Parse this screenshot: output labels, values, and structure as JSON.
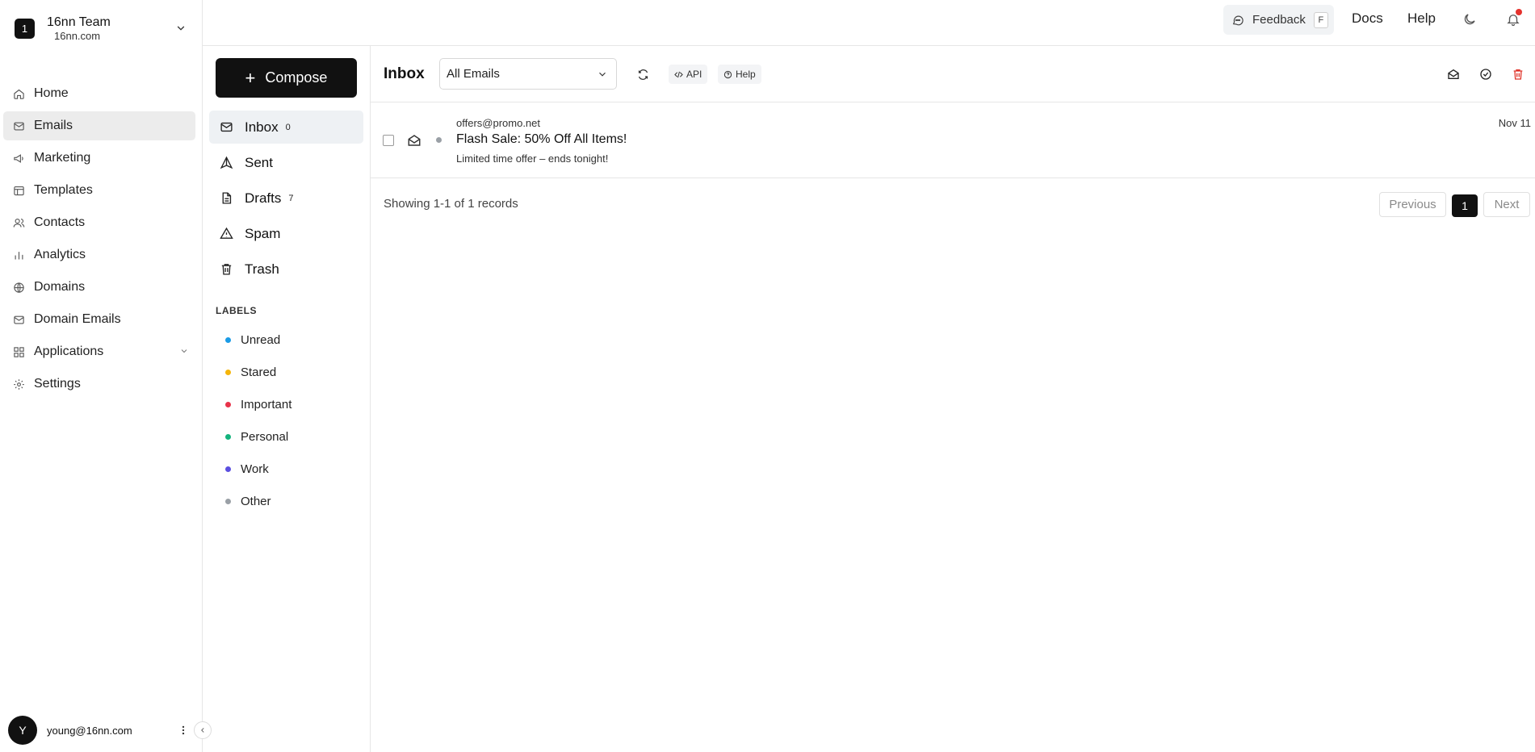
{
  "team": {
    "logo_letter": "1",
    "name": "16nn Team",
    "domain": "16nn.com"
  },
  "nav": {
    "items": [
      {
        "label": "Home",
        "icon": "home-icon"
      },
      {
        "label": "Emails",
        "icon": "mail-icon",
        "active": true
      },
      {
        "label": "Marketing",
        "icon": "megaphone-icon"
      },
      {
        "label": "Templates",
        "icon": "template-icon"
      },
      {
        "label": "Contacts",
        "icon": "users-icon"
      },
      {
        "label": "Analytics",
        "icon": "bar-chart-icon"
      },
      {
        "label": "Domains",
        "icon": "globe-icon"
      },
      {
        "label": "Domain Emails",
        "icon": "mail-icon"
      },
      {
        "label": "Applications",
        "icon": "grid-icon",
        "expandable": true
      },
      {
        "label": "Settings",
        "icon": "gear-icon"
      }
    ]
  },
  "user": {
    "initial": "Y",
    "email": "young@16nn.com"
  },
  "header": {
    "feedback_label": "Feedback",
    "feedback_shortcut": "F",
    "docs_label": "Docs",
    "help_label": "Help"
  },
  "folders": {
    "compose_label": "Compose",
    "items": [
      {
        "label": "Inbox",
        "count": "0",
        "icon": "mail-icon",
        "active": true
      },
      {
        "label": "Sent",
        "count": "",
        "icon": "send-icon"
      },
      {
        "label": "Drafts",
        "count": "7",
        "icon": "file-icon"
      },
      {
        "label": "Spam",
        "count": "",
        "icon": "warning-icon"
      },
      {
        "label": "Trash",
        "count": "",
        "icon": "trash-icon"
      }
    ],
    "labels_title": "LABELS",
    "labels": [
      {
        "label": "Unread",
        "color": "#1a9be6"
      },
      {
        "label": "Stared",
        "color": "#f5b50a"
      },
      {
        "label": "Important",
        "color": "#e8334a"
      },
      {
        "label": "Personal",
        "color": "#14b37d"
      },
      {
        "label": "Work",
        "color": "#5b4fe0"
      },
      {
        "label": "Other",
        "color": "#9aa0a6"
      }
    ]
  },
  "toolbar": {
    "title": "Inbox",
    "filter_value": "All Emails",
    "api_label": "API",
    "help_label": "Help"
  },
  "emails": [
    {
      "from": "offers@promo.net",
      "subject": "Flash Sale: 50% Off All Items!",
      "snippet": "Limited time offer – ends tonight!",
      "date": "Nov 11"
    }
  ],
  "pagination": {
    "records_text": "Showing 1-1 of 1 records",
    "previous_label": "Previous",
    "current_page": "1",
    "next_label": "Next"
  }
}
